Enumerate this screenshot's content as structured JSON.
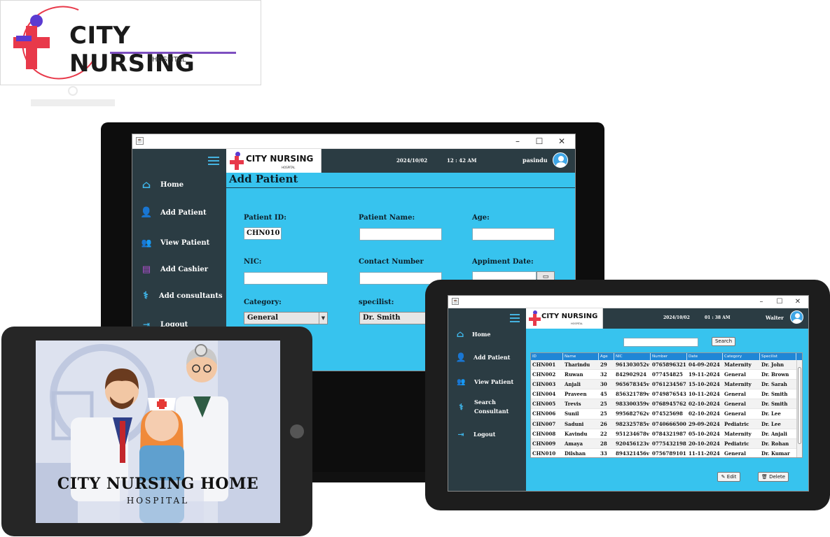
{
  "brand": {
    "name": "CITY NURSING",
    "subtitle": "HOSPITAL",
    "colors": {
      "red": "#e8394a",
      "purple": "#5b3bd1",
      "sidebar": "#2b3c43",
      "content": "#37c3ee",
      "table_header": "#1f86d6"
    }
  },
  "monitor": {
    "window": {
      "minimize": "–",
      "maximize": "☐",
      "close": "✕"
    },
    "header": {
      "date": "2024/10/02",
      "time": "12 : 42 AM",
      "user": "pasindu"
    },
    "sidebar": [
      {
        "label": "Home",
        "icon": "home-icon"
      },
      {
        "label": "Add Patient",
        "icon": "add-user-icon"
      },
      {
        "label": "View Patient",
        "icon": "users-icon"
      },
      {
        "label": "Add Cashier",
        "icon": "cash-register-icon"
      },
      {
        "label": "Add consultants",
        "icon": "stethoscope-icon"
      },
      {
        "label": "Logout",
        "icon": "logout-icon"
      }
    ],
    "page_title": "Add Patient",
    "form": {
      "patient_id_label": "Patient ID:",
      "patient_id_value": "CHN010",
      "patient_name_label": "Patient Name:",
      "age_label": "Age:",
      "nic_label": "NIC:",
      "contact_label": "Contact Number",
      "appointment_label": "Appiment Date:",
      "category_label": "Category:",
      "category_value": "General",
      "specialist_label": "specilist:",
      "specialist_value": "Dr. Smith"
    }
  },
  "left_tablet": {
    "title": "CITY NURSING HOME",
    "subtitle": "HOSPITAL"
  },
  "right_tablet": {
    "window": {
      "minimize": "–",
      "maximize": "☐",
      "close": "✕"
    },
    "header": {
      "date": "2024/10/02",
      "time": "01 : 38 AM",
      "user": "Walter"
    },
    "sidebar": [
      {
        "label": "Home",
        "icon": "home-icon"
      },
      {
        "label": "Add Patient",
        "icon": "add-user-icon"
      },
      {
        "label": "View Patient",
        "icon": "users-icon"
      },
      {
        "label": "Search Consultant",
        "icon": "stethoscope-icon"
      },
      {
        "label": "Logout",
        "icon": "logout-icon"
      }
    ],
    "search_button": "Search",
    "table": {
      "columns": [
        "ID",
        "Name",
        "Age",
        "NIC",
        "Number",
        "Date",
        "Category",
        "Specilist"
      ],
      "rows": [
        [
          "CHN001",
          "Tharindu",
          "29",
          "961303052v",
          "0765896321",
          "04-09-2024",
          "Maternity",
          "Dr. John"
        ],
        [
          "CHN002",
          "Ruwan",
          "32",
          "842902924",
          "077454825",
          "19-11-2024",
          "General",
          "Dr. Brown"
        ],
        [
          "CHN003",
          "Anjali",
          "30",
          "965678345v",
          "0761234567",
          "15-10-2024",
          "Maternity",
          "Dr. Sarah"
        ],
        [
          "CHN004",
          "Praveen",
          "45",
          "856321789v",
          "0749876543",
          "10-11-2024",
          "General",
          "Dr. Smith"
        ],
        [
          "CHN005",
          "Trevis",
          "25",
          "983300359v",
          "0768945762",
          "02-10-2024",
          "General",
          "Dr. Smith"
        ],
        [
          "CHN006",
          "Sunil",
          "25",
          "995682762v",
          "074525698",
          "02-10-2024",
          "General",
          "Dr. Lee"
        ],
        [
          "CHN007",
          "Saduni",
          "26",
          "982325785v",
          "0740666500",
          "29-09-2024",
          "Pediatric",
          "Dr. Lee"
        ],
        [
          "CHN008",
          "Kavindu",
          "22",
          "951234678v",
          "0784321987",
          "05-10-2024",
          "Maternity",
          "Dr. Anjali"
        ],
        [
          "CHN009",
          "Amaya",
          "28",
          "920456123v",
          "0775432198",
          "20-10-2024",
          "Pediatric",
          "Dr. Rohan"
        ],
        [
          "CHN010",
          "Dilshan",
          "33",
          "894321456v",
          "0756789101",
          "11-11-2024",
          "General",
          "Dr. Kumar"
        ]
      ]
    },
    "edit_button": "Edit",
    "delete_button": "Delete"
  }
}
